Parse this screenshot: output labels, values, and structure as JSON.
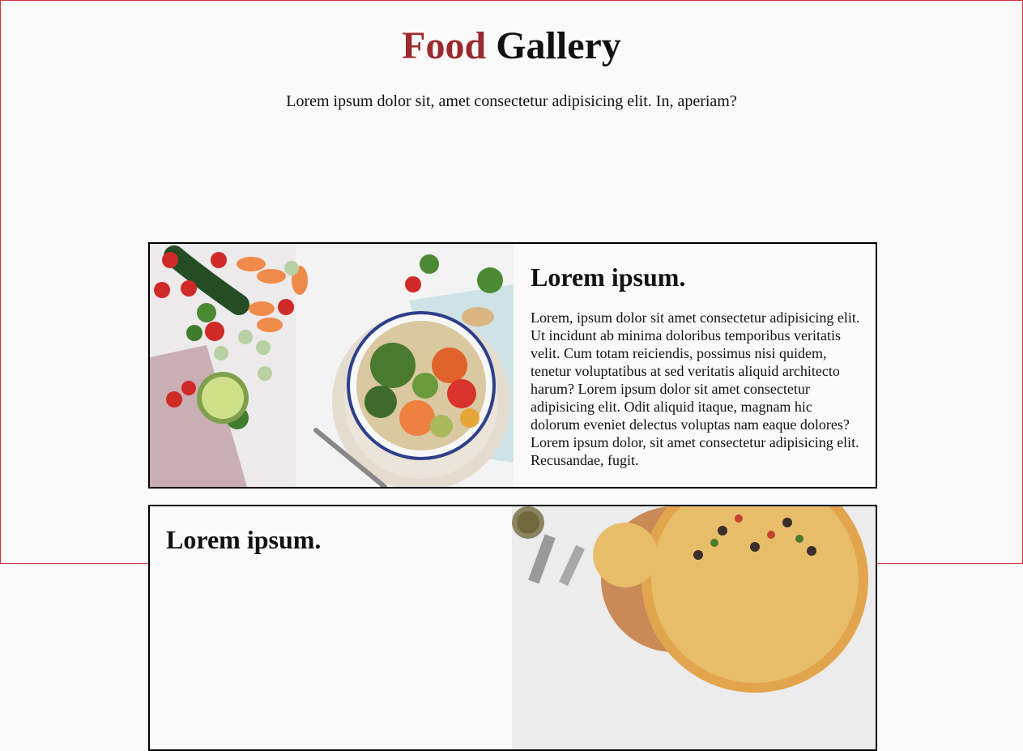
{
  "header": {
    "title_accent": "Food",
    "title_rest": "Gallery",
    "subtitle": "Lorem ipsum dolor sit, amet consectetur adipisicing elit. In, aperiam?"
  },
  "cards": [
    {
      "heading": "Lorem ipsum.",
      "body": "Lorem, ipsum dolor sit amet consectetur adipisicing elit. Ut incidunt ab minima doloribus temporibus veritatis velit. Cum totam reiciendis, possimus nisi quidem, tenetur voluptatibus at sed veritatis aliquid architecto harum? Lorem ipsum dolor sit amet consectetur adipisicing elit. Odit aliquid itaque, magnam hic dolorum eveniet delectus voluptas nam eaque dolores? Lorem ipsum dolor, sit amet consectetur adipisicing elit. Recusandae, fugit.",
      "image": "vegetable-bowl-photo"
    },
    {
      "heading": "Lorem ipsum.",
      "image": "pizza-photo"
    }
  ],
  "colors": {
    "accent": "#9b2a2e",
    "page_border": "#d0343c"
  }
}
